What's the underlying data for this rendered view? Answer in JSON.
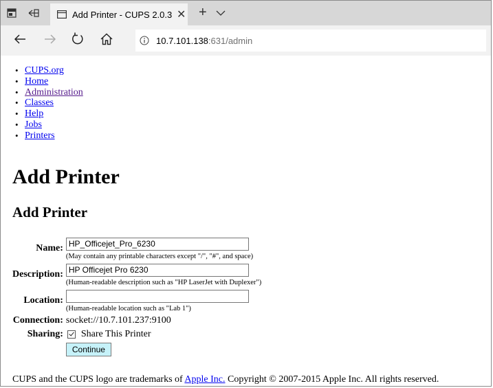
{
  "browser": {
    "tab": {
      "title": "Add Printer - CUPS 2.0.3",
      "close_glyph": "✕"
    },
    "new_tab_glyph": "+",
    "address": {
      "host": "10.7.101.138",
      "rest": ":631/admin"
    }
  },
  "nav_links": [
    {
      "label": "CUPS.org"
    },
    {
      "label": "Home"
    },
    {
      "label": "Administration"
    },
    {
      "label": "Classes"
    },
    {
      "label": "Help"
    },
    {
      "label": "Jobs"
    },
    {
      "label": "Printers"
    }
  ],
  "page_title": "Add Printer",
  "section_title": "Add Printer",
  "form": {
    "name": {
      "label": "Name:",
      "value": "HP_Officejet_Pro_6230",
      "hint": "(May contain any printable characters except \"/\", \"#\", and space)"
    },
    "description": {
      "label": "Description:",
      "value": "HP Officejet Pro 6230",
      "hint": "(Human-readable description such as \"HP LaserJet with Duplexer\")"
    },
    "location": {
      "label": "Location:",
      "value": "",
      "hint": "(Human-readable location such as \"Lab 1\")"
    },
    "connection": {
      "label": "Connection:",
      "value": "socket://10.7.101.237:9100"
    },
    "sharing": {
      "label": "Sharing:",
      "checkbox_label": "Share This Printer",
      "checked": true
    },
    "continue_label": "Continue"
  },
  "footer": {
    "prefix": "CUPS and the CUPS logo are trademarks of ",
    "link": "Apple Inc.",
    "suffix": " Copyright © 2007-2015 Apple Inc. All rights reserved."
  },
  "colors": {
    "link": "#0000ee",
    "visited_link": "#551a8b",
    "button_bg": "#c6f2f9"
  }
}
